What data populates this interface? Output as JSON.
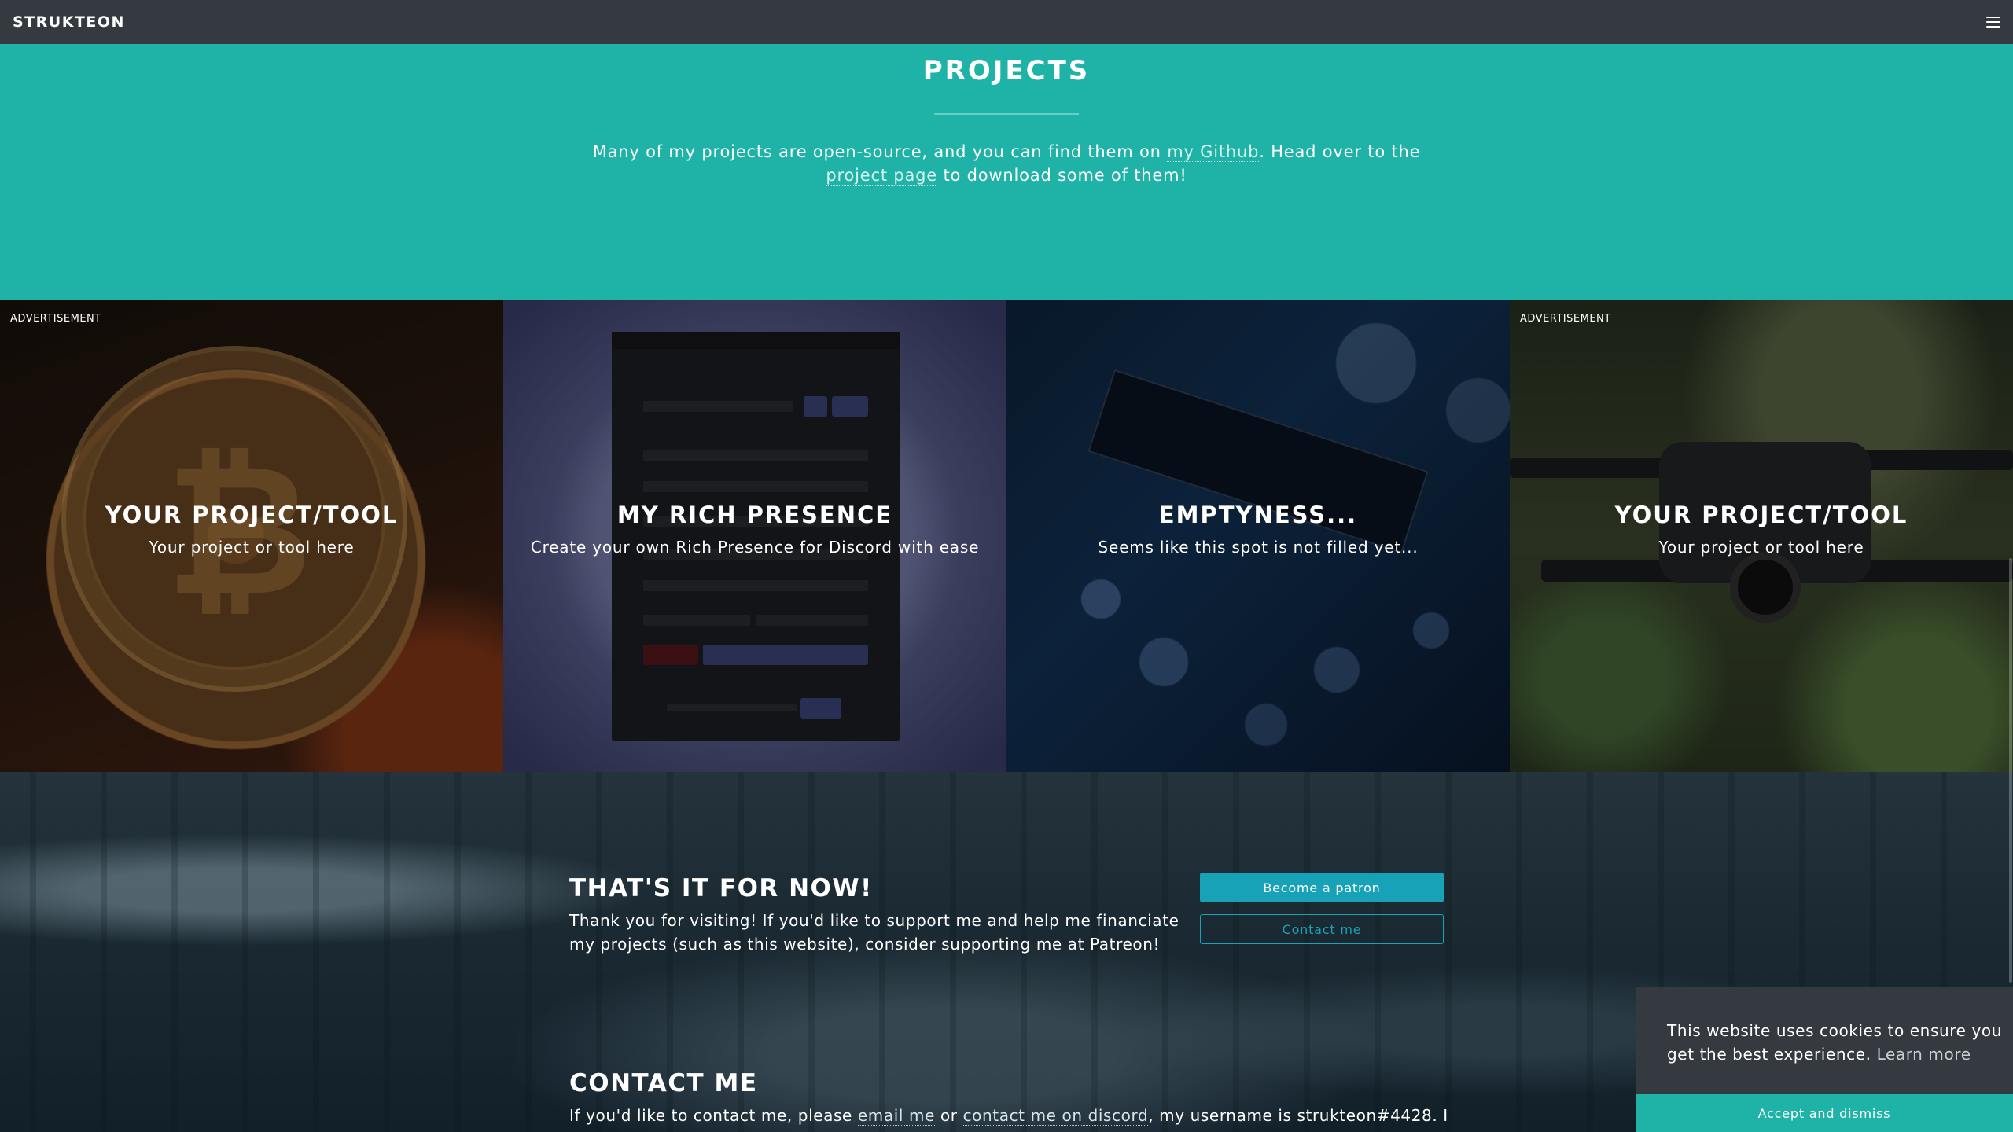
{
  "navbar": {
    "brand": "STRUKTEON",
    "menu_icon": "hamburger-icon"
  },
  "projects": {
    "title": "PROJECTS",
    "text_before_github": "Many of my projects are open-source, and you can find them on ",
    "github_link": "my Github",
    "text_middle": ". Head over to the ",
    "project_page_link": "project page",
    "text_after": " to download some of them!"
  },
  "tiles": [
    {
      "ad_label": "ADVERTISEMENT",
      "title": "YOUR PROJECT/TOOL",
      "subtitle": "Your project or tool here"
    },
    {
      "ad_label": "",
      "title": "MY RICH PRESENCE",
      "subtitle": "Create your own Rich Presence for Discord with ease"
    },
    {
      "ad_label": "",
      "title": "EMPTYNESS...",
      "subtitle": "Seems like this spot is not filled yet..."
    },
    {
      "ad_label": "ADVERTISEMENT",
      "title": "YOUR PROJECT/TOOL",
      "subtitle": "Your project or tool here"
    }
  ],
  "thanks": {
    "title": "THAT'S IT FOR NOW!",
    "text": "Thank you for visiting! If you'd like to support me and help me financiate my projects (such as this website), consider supporting me at Patreon!",
    "patron_button": "Become a patron",
    "contact_button": "Contact me"
  },
  "contact": {
    "title": "CONTACT ME",
    "text_before_email": "If you'd like to contact me, please ",
    "email_link": "email me",
    "text_or": " or ",
    "discord_link": "contact me on discord",
    "text_after": ", my username is strukteon#4428. I"
  },
  "cookie": {
    "text": "This website uses cookies to ensure you get the best experience. ",
    "learn_more": "Learn more",
    "accept_button": "Accept and dismiss"
  },
  "colors": {
    "navbar": "#343a40",
    "teal": "#1fb2a6",
    "info": "#17a2b8"
  }
}
